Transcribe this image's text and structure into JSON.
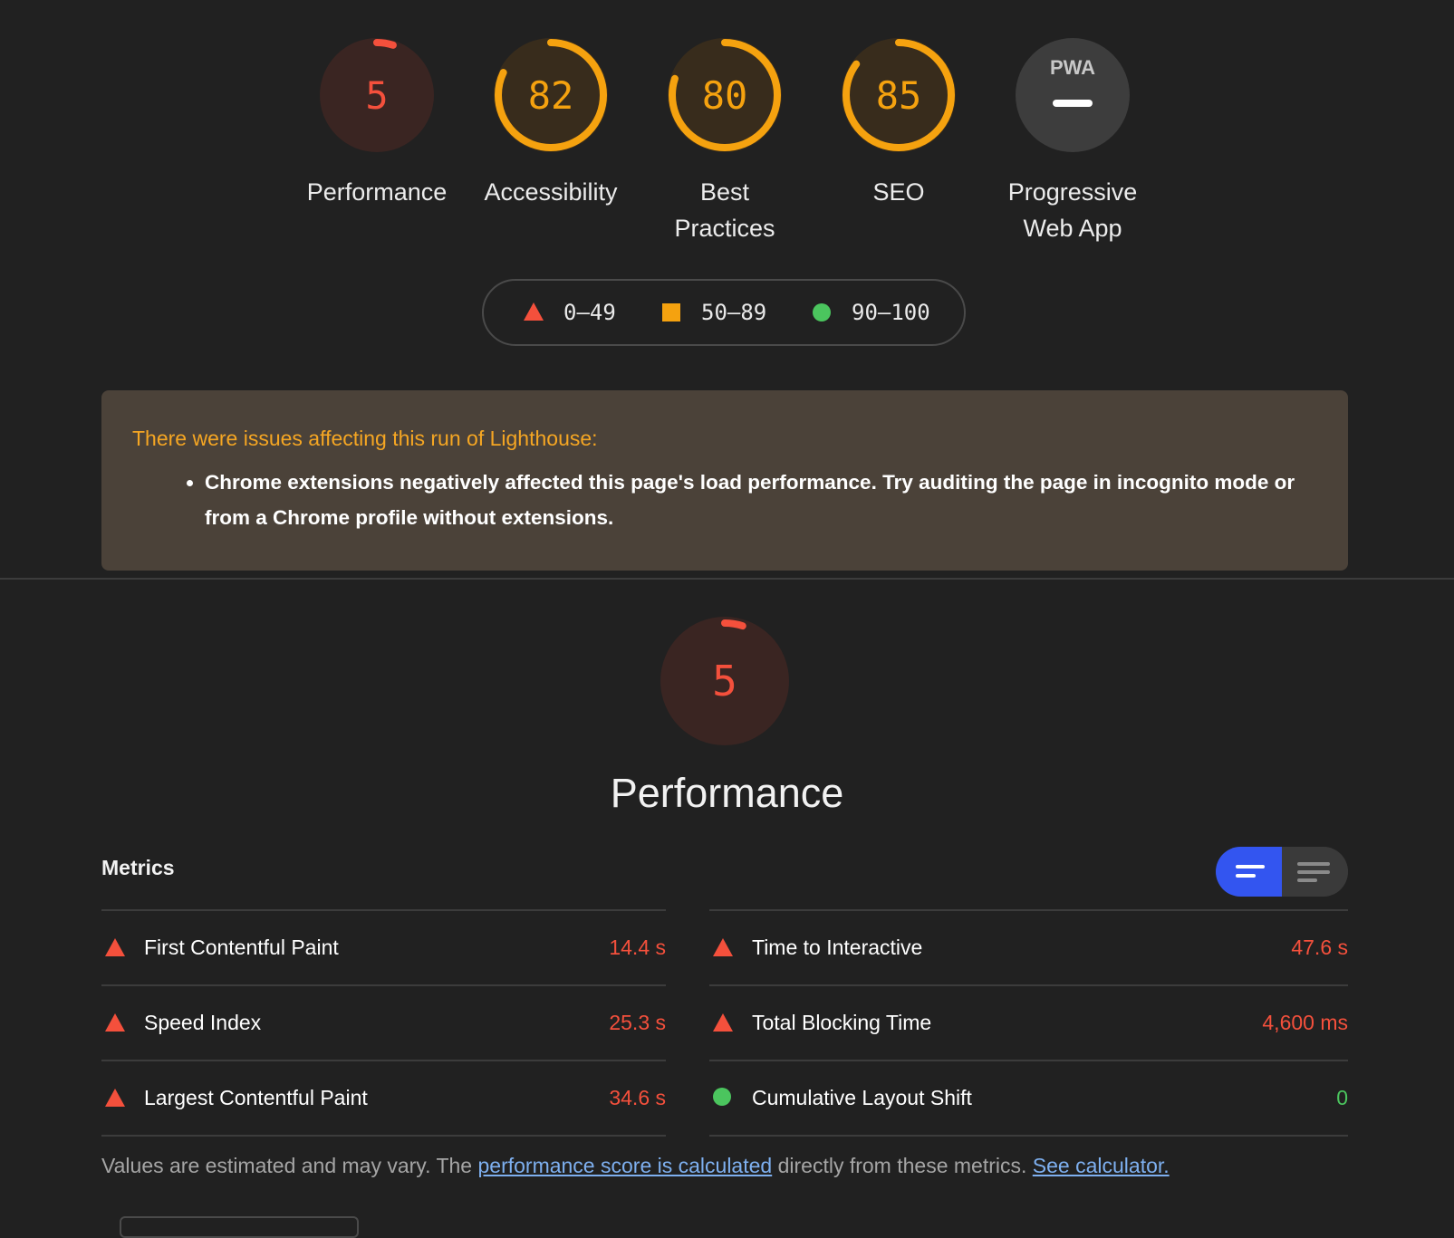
{
  "colors": {
    "fail": "#f4503c",
    "average": "#f5a20f",
    "pass": "#4bc55e",
    "background": "#212121",
    "link": "#7eb0f0",
    "toggle_active": "#3355f0",
    "warning_title": "#f5a623",
    "warning_bg": "#4b4239"
  },
  "gauges": [
    {
      "label": "Performance",
      "score": "5",
      "score_value": 5,
      "rating": "fail"
    },
    {
      "label": "Accessibility",
      "score": "82",
      "score_value": 82,
      "rating": "average"
    },
    {
      "label": "Best Practices",
      "score": "80",
      "score_value": 80,
      "rating": "average"
    },
    {
      "label": "SEO",
      "score": "85",
      "score_value": 85,
      "rating": "average"
    },
    {
      "label": "Progressive Web App",
      "badge": "PWA",
      "score": "",
      "rating": "na"
    }
  ],
  "legend": [
    {
      "range": "0–49",
      "icon": "triangle-icon"
    },
    {
      "range": "50–89",
      "icon": "square-icon"
    },
    {
      "range": "90–100",
      "icon": "circle-icon"
    }
  ],
  "warning": {
    "title": "There were issues affecting this run of Lighthouse:",
    "items": [
      "Chrome extensions negatively affected this page's load performance. Try auditing the page in incognito mode or from a Chrome profile without extensions."
    ]
  },
  "performance": {
    "score": "5",
    "score_value": 5,
    "title": "Performance"
  },
  "metrics": {
    "title": "Metrics",
    "left": [
      {
        "name": "First Contentful Paint",
        "value": "14.4 s",
        "rating": "fail"
      },
      {
        "name": "Speed Index",
        "value": "25.3 s",
        "rating": "fail"
      },
      {
        "name": "Largest Contentful Paint",
        "value": "34.6 s",
        "rating": "fail"
      }
    ],
    "right": [
      {
        "name": "Time to Interactive",
        "value": "47.6 s",
        "rating": "fail"
      },
      {
        "name": "Total Blocking Time",
        "value": "4,600 ms",
        "rating": "fail"
      },
      {
        "name": "Cumulative Layout Shift",
        "value": "0",
        "rating": "pass"
      }
    ]
  },
  "footnote": {
    "prefix": "Values are estimated and may vary. The ",
    "link1": "performance score is calculated",
    "middle": " directly from these metrics. ",
    "link2": "See calculator."
  }
}
